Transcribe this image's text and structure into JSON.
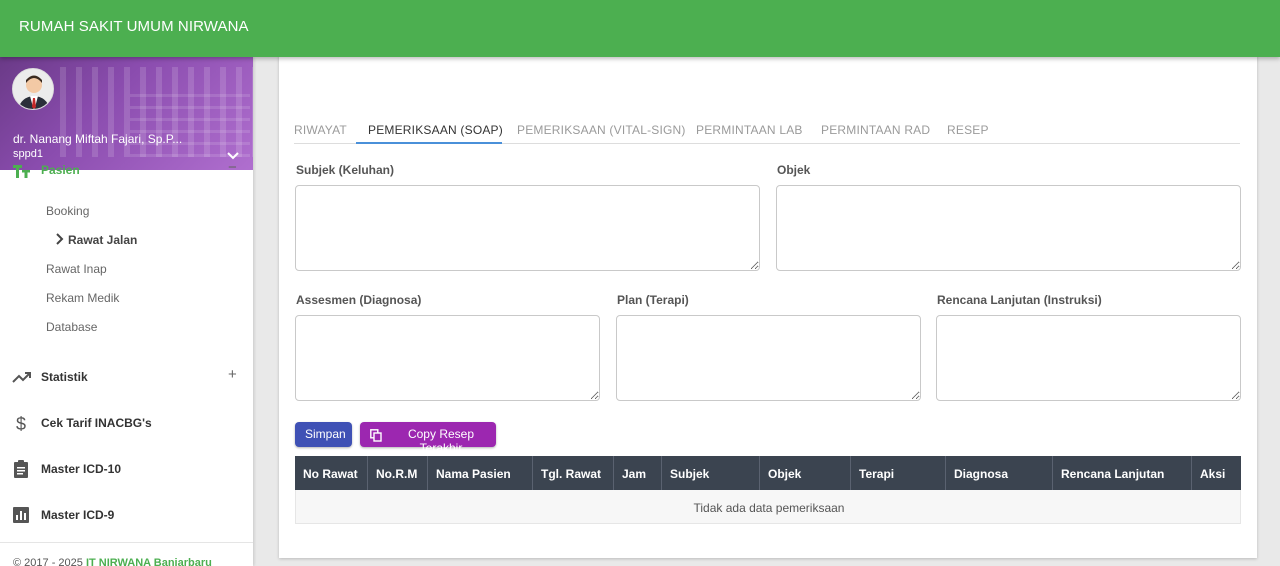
{
  "app": {
    "title": "RUMAH SAKIT UMUM NIRWANA"
  },
  "user": {
    "name": "dr. Nanang Miftah Fajari, Sp.P...",
    "username": "sppd1"
  },
  "menu": {
    "pasien": {
      "label": "Pasien",
      "toggle": "−"
    },
    "sub": [
      {
        "label": "Booking"
      },
      {
        "label": "Rawat Jalan",
        "chev": "›"
      },
      {
        "label": "Rawat Inap"
      },
      {
        "label": "Rekam Medik"
      },
      {
        "label": "Database"
      }
    ],
    "statistik": {
      "label": "Statistik",
      "toggle": "+"
    },
    "tarif": {
      "label": "Cek Tarif INACBG's"
    },
    "icd10": {
      "label": "Master ICD-10"
    },
    "icd9": {
      "label": "Master ICD-9"
    }
  },
  "footer": {
    "prefix": "© 2017 - 2025 ",
    "org": "IT NIRWANA Banjarbaru"
  },
  "tabs": [
    {
      "label": "RIWAYAT"
    },
    {
      "label": "PEMERIKSAAN (SOAP)"
    },
    {
      "label": "PEMERIKSAAN (VITAL-SIGN)"
    },
    {
      "label": "PERMINTAAN LAB"
    },
    {
      "label": "PERMINTAAN RAD"
    },
    {
      "label": "RESEP"
    }
  ],
  "form": {
    "subjek": "Subjek (Keluhan)",
    "objek": "Objek",
    "assesmen": "Assesmen (Diagnosa)",
    "plan": "Plan (Terapi)",
    "rencana": "Rencana Lanjutan (Instruksi)"
  },
  "buttons": {
    "simpan": "Simpan",
    "copy": "Copy Resep Terakhir"
  },
  "table": {
    "headers": [
      "No Rawat",
      "No.R.M",
      "Nama Pasien",
      "Tgl. Rawat",
      "Jam",
      "Subjek",
      "Objek",
      "Terapi",
      "Diagnosa",
      "Rencana Lanjutan",
      "Aksi"
    ],
    "empty": "Tidak ada data pemeriksaan"
  },
  "colors": {
    "primary": "#4caf50",
    "simpan": "#3f51b5",
    "copy": "#9c27b0",
    "tab_active": "#4a90d9"
  },
  "icons": {
    "pasien": "text-format-icon",
    "statistik": "trending-up-icon",
    "tarif": "dollar-icon",
    "icd10": "clipboard-icon",
    "icd9": "bar-chart-icon",
    "copy": "copy-icon"
  }
}
